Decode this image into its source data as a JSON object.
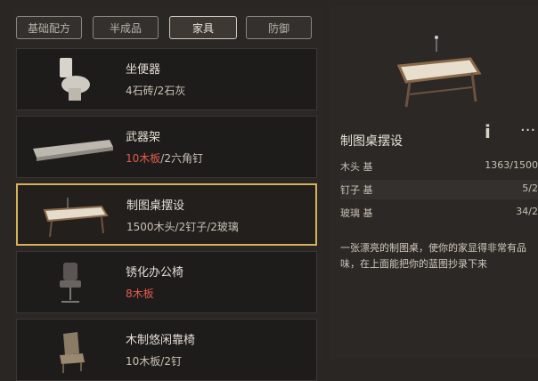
{
  "tabs": [
    {
      "label": "基础配方",
      "active": false
    },
    {
      "label": "半成品",
      "active": false
    },
    {
      "label": "家具",
      "active": true
    },
    {
      "label": "防御",
      "active": false
    }
  ],
  "items": [
    {
      "name": "坐便器",
      "cost": "4石砖/2石灰",
      "cost_red": false,
      "selected": false,
      "icon": "toilet-icon"
    },
    {
      "name": "武器架",
      "cost_red_part": "10木板",
      "cost_rest": "/2六角钉",
      "selected": false,
      "icon": "weapon-rack-icon"
    },
    {
      "name": "制图桌摆设",
      "cost": "1500木头/2钉子/2玻璃",
      "cost_red": false,
      "selected": true,
      "icon": "drafting-table-icon"
    },
    {
      "name": "锈化办公椅",
      "cost": "8木板",
      "cost_red": true,
      "selected": false,
      "icon": "office-chair-icon"
    },
    {
      "name": "木制悠闲靠椅",
      "cost": "10木板/2钉",
      "cost_red": false,
      "selected": false,
      "icon": "lounge-chair-icon"
    }
  ],
  "detail": {
    "title": "制图桌摆设",
    "info_label": "i",
    "more_label": "···",
    "requirements": [
      {
        "name": "木头 基",
        "value": "1363/1500"
      },
      {
        "name": "钉子 基",
        "value": "5/2"
      },
      {
        "name": "玻璃 基",
        "value": "34/2"
      }
    ],
    "description": "一张漂亮的制图桌，使你的家显得非常有品味，在上面能把你的蓝图抄录下来"
  },
  "colors": {
    "accent": "#d8b25a",
    "insufficient": "#e25a4e"
  }
}
